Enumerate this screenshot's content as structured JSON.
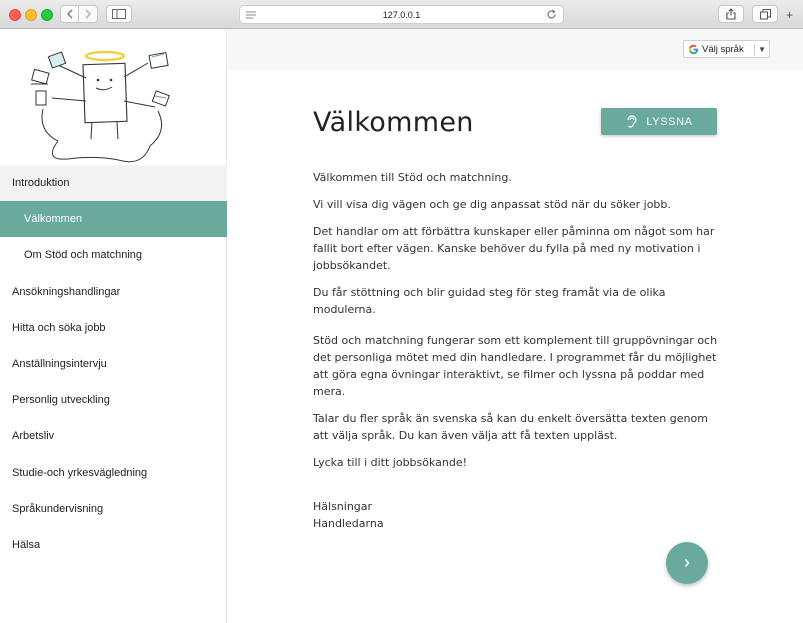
{
  "browser": {
    "url": "127.0.0.1"
  },
  "sidebar": {
    "items": [
      {
        "label": "Introduktion"
      },
      {
        "label": "Välkommen"
      },
      {
        "label": "Om Stöd och matchning"
      },
      {
        "label": "Ansökningshandlingar"
      },
      {
        "label": "Hitta och söka jobb"
      },
      {
        "label": "Anställningsintervju"
      },
      {
        "label": "Personlig utveckling"
      },
      {
        "label": "Arbetsliv"
      },
      {
        "label": "Studie-och yrkesvägledning"
      },
      {
        "label": "Språkundervisning"
      },
      {
        "label": "Hälsa"
      }
    ]
  },
  "translate": {
    "label": "Välj språk",
    "arrow": "▼"
  },
  "main": {
    "title": "Välkommen",
    "listen_label": "LYSSNA",
    "paragraphs": [
      "Välkommen till Stöd och matchning.",
      "Vi vill visa dig vägen och ge dig anpassat stöd när du söker jobb.",
      "Det handlar om att förbättra kunskaper eller påminna om något som har fallit bort efter vägen. Kanske behöver du fylla på med ny motivation i jobbsökandet.",
      "Du får stöttning och blir guidad steg för steg framåt via de olika modulerna.",
      "Stöd och matchning fungerar som ett komplement till gruppövningar och det personliga mötet med din handledare. I programmet får du möjlighet att göra egna övningar interaktivt, se filmer och lyssna på poddar med mera.",
      "Talar du fler språk än svenska så kan du enkelt översätta texten genom att välja språk. Du kan även välja att få texten uppläst.",
      "Lycka till i ditt jobbsökande!"
    ],
    "signature_line1": "Hälsningar",
    "signature_line2": "Handledarna"
  },
  "colors": {
    "accent": "#6aaa9c"
  }
}
